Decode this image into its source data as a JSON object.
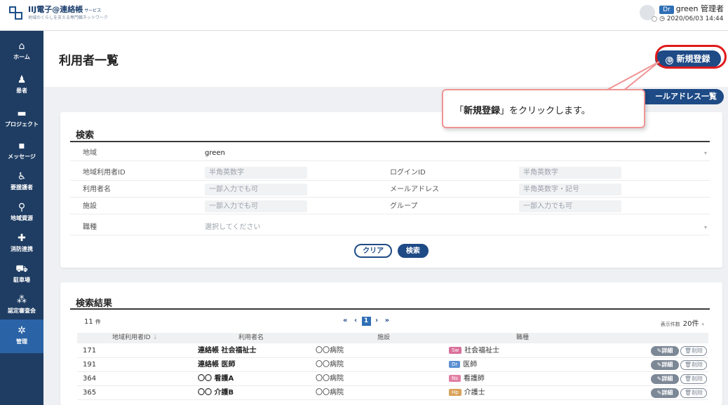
{
  "app": {
    "title": "IIJ電子@連絡帳",
    "title_suffix": "サービス",
    "subtitle": "地域のくらしを支える専門職ネットワーク"
  },
  "user": {
    "role": "Dr",
    "name": "green 管理者",
    "datetime": "2020/06/03 14:44"
  },
  "sidebar": {
    "items": [
      {
        "label": "ホーム",
        "icon": "home-icon"
      },
      {
        "label": "患者",
        "icon": "patient-icon"
      },
      {
        "label": "プロジェクト",
        "icon": "folder-icon"
      },
      {
        "label": "メッセージ",
        "icon": "message-icon"
      },
      {
        "label": "要援護者",
        "icon": "care-icon"
      },
      {
        "label": "地域資源",
        "icon": "map-pin-icon"
      },
      {
        "label": "消防連携",
        "icon": "ambulance-icon"
      },
      {
        "label": "駐車場",
        "icon": "car-icon"
      },
      {
        "label": "認定審査会",
        "icon": "committee-icon"
      },
      {
        "label": "管理",
        "icon": "gear-icon"
      }
    ],
    "active_index": 9
  },
  "header": {
    "title": "利用者一覧",
    "new_button": "新規登録",
    "new_button_icon": "⊕",
    "mail_list_button": "ールアドレス一覧"
  },
  "search": {
    "title": "検索",
    "area_label": "地域",
    "area_value": "green",
    "local_user_id_label": "地域利用者ID",
    "local_user_id_placeholder": "半角英数字",
    "login_id_label": "ログインID",
    "login_id_placeholder": "半角英数字",
    "user_name_label": "利用者名",
    "user_name_placeholder": "一部入力でも可",
    "email_label": "メールアドレス",
    "email_placeholder": "半角英数字・記号",
    "facility_label": "施設",
    "facility_placeholder": "一部入力でも可",
    "group_label": "グループ",
    "group_placeholder": "一部入力でも可",
    "job_label": "職種",
    "job_placeholder": "選択してください",
    "clear_button": "クリア",
    "search_button": "検索"
  },
  "results": {
    "title": "検索結果",
    "count": "11",
    "count_unit": "件",
    "pager": {
      "first": "«",
      "prev": "‹",
      "current": "1",
      "next": "›",
      "last": "»"
    },
    "per_page_label": "表示件数",
    "per_page_value": "20件",
    "columns": {
      "id": "地域利用者ID",
      "name": "利用者名",
      "facility": "施設",
      "job": "職種"
    },
    "detail_label": "詳細",
    "delete_label": "削除",
    "rows": [
      {
        "id": "171",
        "name": "連絡帳 社会福祉士",
        "facility": "〇〇病院",
        "tag": "Sw",
        "tag_color": "#d9709a",
        "job": "社会福祉士"
      },
      {
        "id": "191",
        "name": "連絡帳 医師",
        "facility": "〇〇病院",
        "tag": "Dr",
        "tag_color": "#5b8fd1",
        "job": "医師"
      },
      {
        "id": "364",
        "name": "〇〇 看護A",
        "facility": "〇〇病院",
        "tag": "Ns",
        "tag_color": "#e27fa3",
        "job": "看護師"
      },
      {
        "id": "365",
        "name": "〇〇 介護B",
        "facility": "〇〇病院",
        "tag": "Hp",
        "tag_color": "#d9a25a",
        "job": "介護士"
      }
    ]
  },
  "callout": {
    "open_bracket": "「",
    "strong": "新規登録",
    "rest": "」をクリックします。"
  },
  "colors": {
    "primary": "#1e4a86",
    "sidebar": "#1f3d63",
    "highlight": "#e01a1a",
    "callout_border": "#f09494"
  }
}
